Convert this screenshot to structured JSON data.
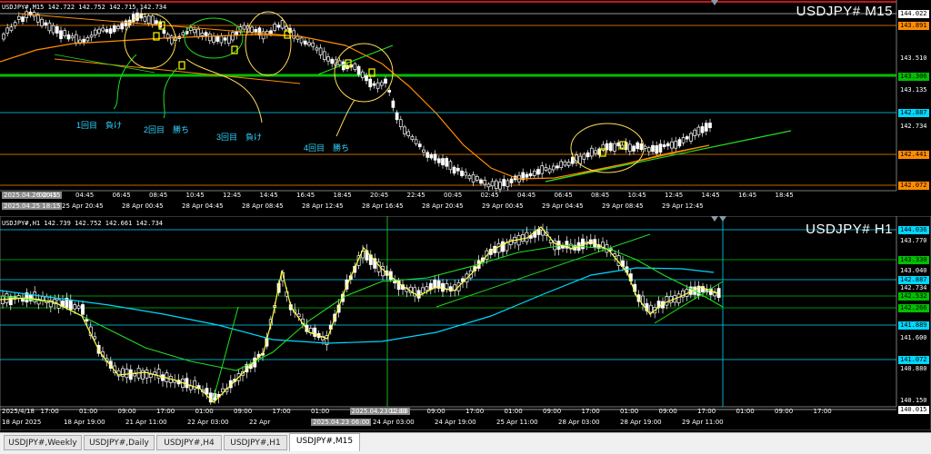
{
  "top": {
    "header": "USDJPY#,M15  142.722 142.752 142.715 142.734",
    "title": "USDJPY# M15",
    "price_labels": [
      {
        "text": "144.022",
        "bg": "#ffffff",
        "boxed": true
      },
      {
        "text": "143.891",
        "bg": "#ff8c00",
        "boxed": true
      },
      {
        "text": "143.510",
        "bg": null,
        "boxed": false
      },
      {
        "text": "143.306",
        "bg": "#00c000",
        "boxed": true
      },
      {
        "text": "143.135",
        "bg": null,
        "boxed": false
      },
      {
        "text": "142.887",
        "bg": "#00d8ff",
        "boxed": true
      },
      {
        "text": "142.734",
        "bg": null,
        "boxed": false
      },
      {
        "text": "142.441",
        "bg": "#ff8c00",
        "boxed": true
      },
      {
        "text": "142.072",
        "bg": "#ff8c00",
        "boxed": true
      }
    ],
    "time_labels": [
      "2025.04.26 00:15",
      "02:45",
      "04:45",
      "06:45",
      "08:45",
      "10:45",
      "12:45",
      "14:45",
      "16:45",
      "18:45",
      "20:45",
      "22:45",
      "00:45",
      "02:45",
      "04:45",
      "06:45",
      "08:45",
      "10:45",
      "12:45",
      "14:45",
      "16:45",
      "18:45"
    ],
    "date_labels": [
      "2025.04.25 18:15",
      "25 Apr 20:45",
      "28 Apr 00:45",
      "28 Apr 04:45",
      "28 Apr 08:45",
      "28 Apr 12:45",
      "28 Apr 16:45",
      "28 Apr 20:45",
      "29 Apr 00:45",
      "29 Apr 04:45",
      "29 Apr 08:45",
      "29 Apr 12:45"
    ],
    "annotations": [
      "1回目　負け",
      "2回目　勝ち",
      "3回目　負け",
      "4回目　勝ち"
    ]
  },
  "bottom": {
    "header": "USDJPY#,H1  142.739 142.752 142.661 142.734",
    "title": "USDJPY# H1",
    "price_labels": [
      {
        "text": "144.036",
        "bg": "#00d8ff",
        "boxed": true
      },
      {
        "text": "143.770",
        "bg": null,
        "boxed": false
      },
      {
        "text": "143.330",
        "bg": "#00c000",
        "boxed": true
      },
      {
        "text": "143.040",
        "bg": null,
        "boxed": false
      },
      {
        "text": "142.887",
        "bg": "#00d8ff",
        "boxed": true
      },
      {
        "text": "142.734",
        "bg": null,
        "boxed": false
      },
      {
        "text": "142.532",
        "bg": "#00c000",
        "boxed": true
      },
      {
        "text": "142.266",
        "bg": "#00c000",
        "boxed": true
      },
      {
        "text": "141.889",
        "bg": "#00d8ff",
        "boxed": true
      },
      {
        "text": "141.600",
        "bg": null,
        "boxed": false
      },
      {
        "text": "141.072",
        "bg": "#00d8ff",
        "boxed": true
      },
      {
        "text": "140.880",
        "bg": null,
        "boxed": false
      },
      {
        "text": "140.150",
        "bg": null,
        "boxed": false
      },
      {
        "text": "140.015",
        "bg": "#ffffff",
        "boxed": true
      }
    ],
    "time_labels": [
      "2025/4/18",
      "17:00",
      "01:00",
      "09:00",
      "17:00",
      "01:00",
      "09:00",
      "17:00",
      "01:00",
      "2025.04.23 12:00",
      "01:00",
      "09:00",
      "17:00",
      "01:00",
      "09:00",
      "17:00",
      "01:00",
      "09:00",
      "17:00",
      "01:00",
      "09:00",
      "17:00"
    ],
    "date_labels": [
      "18 Apr 2025",
      "18 Apr 19:00",
      "21 Apr 11:00",
      "22 Apr 03:00",
      "22 Apr",
      "2025.04.23 06:00",
      "24 Apr 03:00",
      "24 Apr 19:00",
      "25 Apr 11:00",
      "28 Apr 03:00",
      "28 Apr 19:00",
      "29 Apr 11:00"
    ]
  },
  "tabs": [
    "USDJPY#,Weekly",
    "USDJPY#,Daily",
    "USDJPY#,H4",
    "USDJPY#,H1",
    "USDJPY#,M15"
  ],
  "active_tab": "USDJPY#,M15",
  "colors": {
    "background": "#000000",
    "candle": "#ffffff",
    "ma_orange": "#ff8c00",
    "trend_green": "#22dd22",
    "ma_cyan": "#00d8ff",
    "marker_yellow": "#ffff00",
    "annotation_text": "#2ed5ff"
  }
}
